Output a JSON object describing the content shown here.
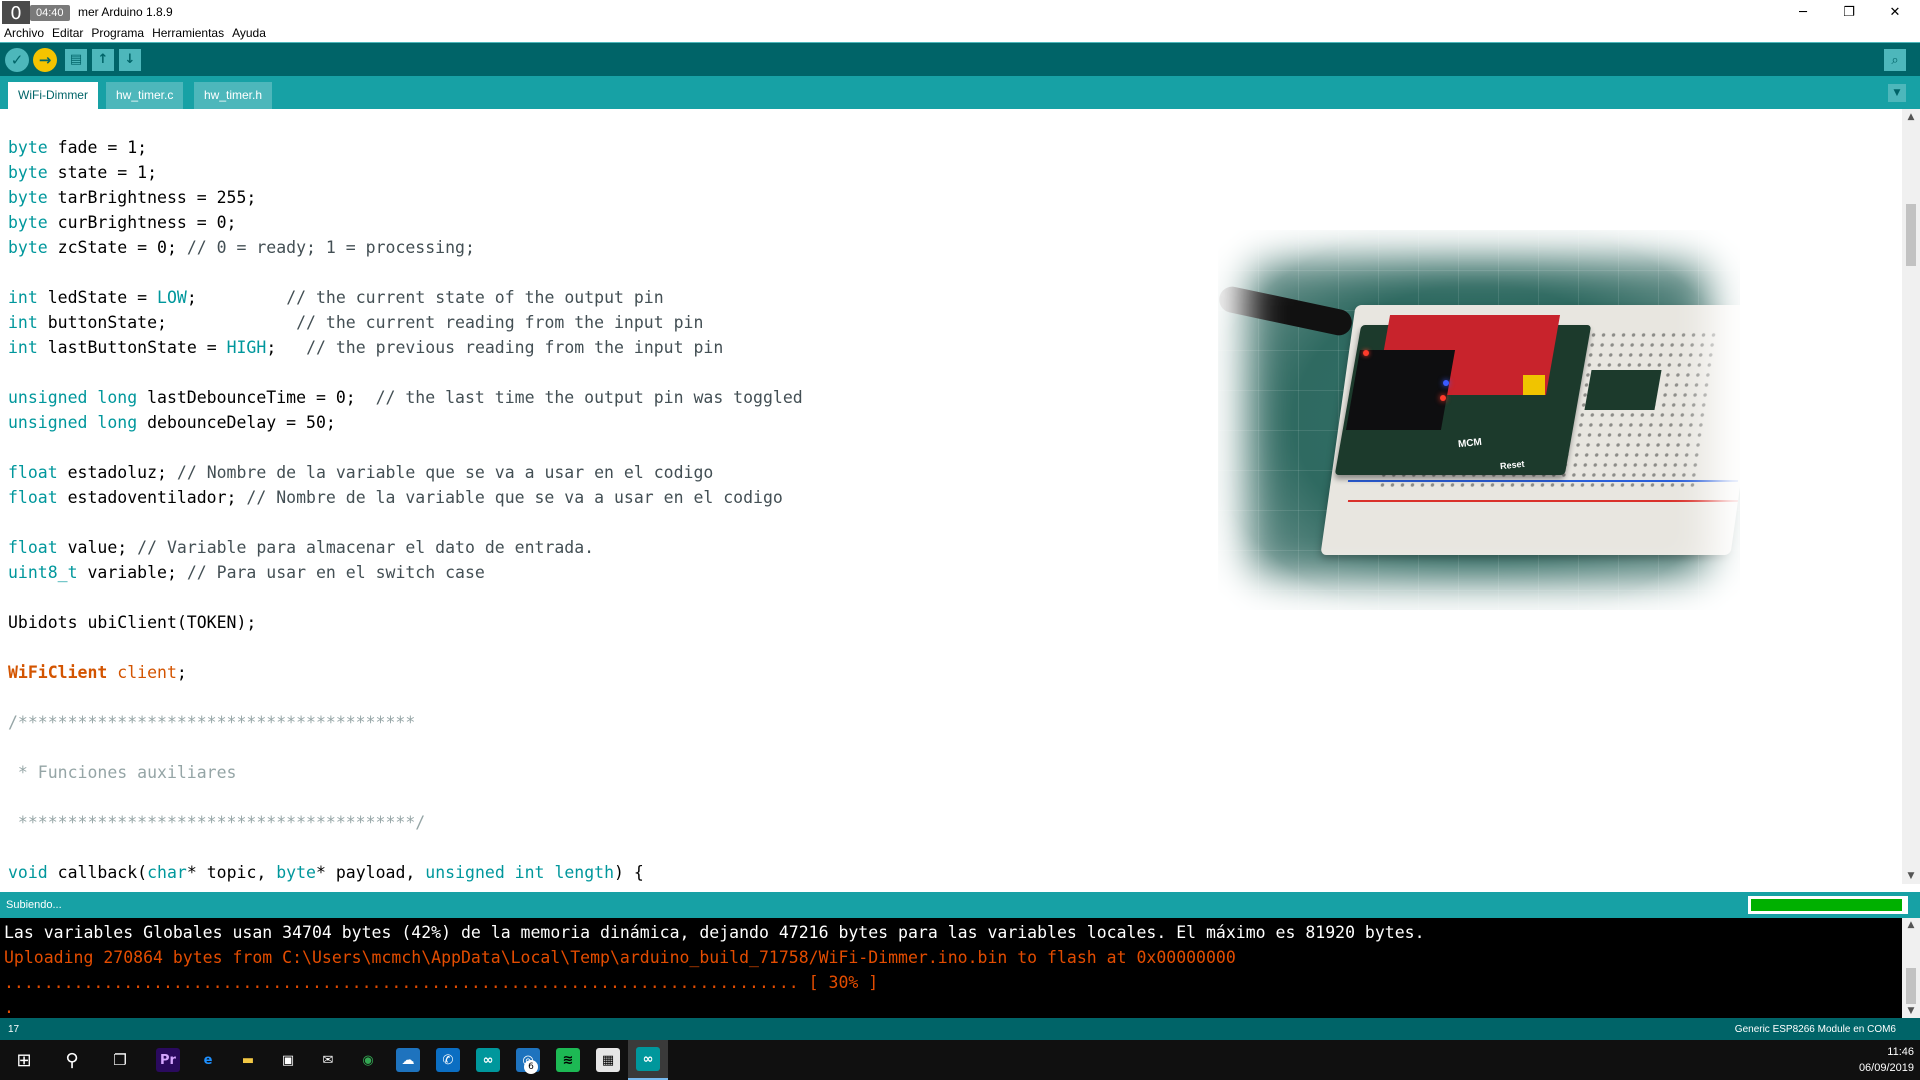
{
  "window": {
    "title": "WiFi-Dimmer Arduino 1.8.9",
    "title_visible": "mer Arduino 1.8.9",
    "overlay_clock": "04:40",
    "logo_glyph": "0",
    "minimize_glyph": "─",
    "maximize_glyph": "❐",
    "close_glyph": "✕"
  },
  "menu": {
    "items": [
      "Archivo",
      "Editar",
      "Programa",
      "Herramientas",
      "Ayuda"
    ]
  },
  "toolbar": {
    "verify_icon": "✓",
    "upload_icon": "→",
    "new_icon": "▤",
    "open_icon": "↑",
    "save_icon": "↓",
    "serial_monitor_icon": "⌕",
    "accent_color": "#006468",
    "upload_active_color": "#f5c400"
  },
  "tabs": {
    "items": [
      "WiFi-Dimmer",
      "hw_timer.c",
      "hw_timer.h"
    ],
    "active": "WiFi-Dimmer",
    "menu_glyph": "▼"
  },
  "editor": {
    "scroll_up": "▲",
    "scroll_down": "▼"
  },
  "code_lines": [
    [
      [
        "kw",
        "byte"
      ],
      [
        "t",
        " fade = 1;"
      ]
    ],
    [
      [
        "kw",
        "byte"
      ],
      [
        "t",
        " state = 1;"
      ]
    ],
    [
      [
        "kw",
        "byte"
      ],
      [
        "t",
        " tarBrightness = 255;"
      ]
    ],
    [
      [
        "kw",
        "byte"
      ],
      [
        "t",
        " curBrightness = 0;"
      ]
    ],
    [
      [
        "kw",
        "byte"
      ],
      [
        "t",
        " zcState = 0; "
      ],
      [
        "cm",
        "// 0 = ready; 1 = processing;"
      ]
    ],
    [
      [
        "t",
        ""
      ]
    ],
    [
      [
        "kw",
        "int"
      ],
      [
        "t",
        " ledState = "
      ],
      [
        "lit",
        "LOW"
      ],
      [
        "t",
        ";         "
      ],
      [
        "cm",
        "// the current state of the output pin"
      ]
    ],
    [
      [
        "kw",
        "int"
      ],
      [
        "t",
        " buttonState;             "
      ],
      [
        "cm",
        "// the current reading from the input pin"
      ]
    ],
    [
      [
        "kw",
        "int"
      ],
      [
        "t",
        " lastButtonState = "
      ],
      [
        "lit",
        "HIGH"
      ],
      [
        "t",
        ";   "
      ],
      [
        "cm",
        "// the previous reading from the input pin"
      ]
    ],
    [
      [
        "t",
        ""
      ]
    ],
    [
      [
        "kw",
        "unsigned long"
      ],
      [
        "t",
        " lastDebounceTime = 0;  "
      ],
      [
        "cm",
        "// the last time the output pin was toggled"
      ]
    ],
    [
      [
        "kw",
        "unsigned long"
      ],
      [
        "t",
        " debounceDelay = 50;"
      ]
    ],
    [
      [
        "t",
        ""
      ]
    ],
    [
      [
        "kw",
        "float"
      ],
      [
        "t",
        " estadoluz; "
      ],
      [
        "cm",
        "// Nombre de la variable que se va a usar en el codigo"
      ]
    ],
    [
      [
        "kw",
        "float"
      ],
      [
        "t",
        " estadoventilador; "
      ],
      [
        "cm",
        "// Nombre de la variable que se va a usar en el codigo"
      ]
    ],
    [
      [
        "t",
        ""
      ]
    ],
    [
      [
        "kw",
        "float"
      ],
      [
        "t",
        " value; "
      ],
      [
        "cm",
        "// Variable para almacenar el dato de entrada."
      ]
    ],
    [
      [
        "kw",
        "uint8_t"
      ],
      [
        "t",
        " variable; "
      ],
      [
        "cm",
        "// Para usar en el switch case"
      ]
    ],
    [
      [
        "t",
        ""
      ]
    ],
    [
      [
        "t",
        "Ubidots ubiClient(TOKEN);"
      ]
    ],
    [
      [
        "t",
        ""
      ]
    ],
    [
      [
        "cls",
        "WiFiClient"
      ],
      [
        "t",
        " "
      ],
      [
        "obj",
        "client"
      ],
      [
        "t",
        ";"
      ]
    ],
    [
      [
        "t",
        ""
      ]
    ],
    [
      [
        "cmb",
        "/****************************************"
      ]
    ],
    [
      [
        "t",
        ""
      ]
    ],
    [
      [
        "cmb",
        " * Funciones auxiliares"
      ]
    ],
    [
      [
        "t",
        ""
      ]
    ],
    [
      [
        "cmb",
        " ****************************************/"
      ]
    ],
    [
      [
        "t",
        ""
      ]
    ],
    [
      [
        "kw",
        "void"
      ],
      [
        "t",
        " callback("
      ],
      [
        "kw",
        "char"
      ],
      [
        "t",
        "* topic, "
      ],
      [
        "kw",
        "byte"
      ],
      [
        "t",
        "* payload, "
      ],
      [
        "kw",
        "unsigned int"
      ],
      [
        "t",
        " "
      ],
      [
        "kw",
        "length"
      ],
      [
        "t",
        ") {"
      ]
    ]
  ],
  "status": {
    "message": "Subiendo...",
    "upload_progress": 0.98,
    "progress_color": "#00b000"
  },
  "console": {
    "lines": [
      {
        "style": "white",
        "text": "Las variables Globales usan 34704 bytes (42%) de la memoria dinámica, dejando 47216 bytes para las variables locales. El máximo es 81920 bytes."
      },
      {
        "style": "orange",
        "text": "Uploading 270864 bytes from C:\\Users\\mcmch\\AppData\\Local\\Temp\\arduino_build_71758/WiFi-Dimmer.ino.bin to flash at 0x00000000"
      },
      {
        "style": "orange",
        "text": "................................................................................ [ 30% ]"
      },
      {
        "style": "orange",
        "text": "."
      }
    ]
  },
  "footer": {
    "line_number": "17",
    "board": "Generic ESP8266 Module en COM6"
  },
  "board_photo": {
    "pcb_text": "MCM",
    "reset_label": "Reset"
  },
  "taskbar": {
    "start_icon": "⊞",
    "search_icon": "⚲",
    "taskview_icon": "❐",
    "apps": [
      {
        "name": "premiere-icon",
        "glyph": "Pr",
        "color": "#2a0a5e",
        "fg": "#d5a6ff"
      },
      {
        "name": "edge-icon",
        "glyph": "e",
        "color": "#101010",
        "fg": "#1e90ff"
      },
      {
        "name": "file-explorer-icon",
        "glyph": "▬",
        "color": "#101010",
        "fg": "#f2c744"
      },
      {
        "name": "store-icon",
        "glyph": "▣",
        "color": "#101010",
        "fg": "#ffffff"
      },
      {
        "name": "mail-icon",
        "glyph": "✉",
        "color": "#101010",
        "fg": "#ffffff"
      },
      {
        "name": "chrome-icon",
        "glyph": "◉",
        "color": "#101010",
        "fg": "#34a853"
      },
      {
        "name": "cloud-icon",
        "glyph": "☁",
        "color": "#1e73be",
        "fg": "#ffffff"
      },
      {
        "name": "whatsapp-icon",
        "glyph": "✆",
        "color": "#0b6ec2",
        "fg": "#ffffff"
      },
      {
        "name": "arduino-icon",
        "glyph": "∞",
        "color": "#00979c",
        "fg": "#ffffff"
      },
      {
        "name": "camera-icon",
        "glyph": "◎",
        "color": "#1e73be",
        "fg": "#ffffff",
        "badge": "6"
      },
      {
        "name": "spotify-icon",
        "glyph": "≋",
        "color": "#1db954",
        "fg": "#000000"
      },
      {
        "name": "tool-icon",
        "glyph": "▦",
        "color": "#e6e6e6",
        "fg": "#000000"
      },
      {
        "name": "arduino-active-icon",
        "glyph": "∞",
        "color": "#00979c",
        "fg": "#ffffff",
        "active": true
      }
    ],
    "time": "11:46",
    "date": "06/09/2019"
  }
}
